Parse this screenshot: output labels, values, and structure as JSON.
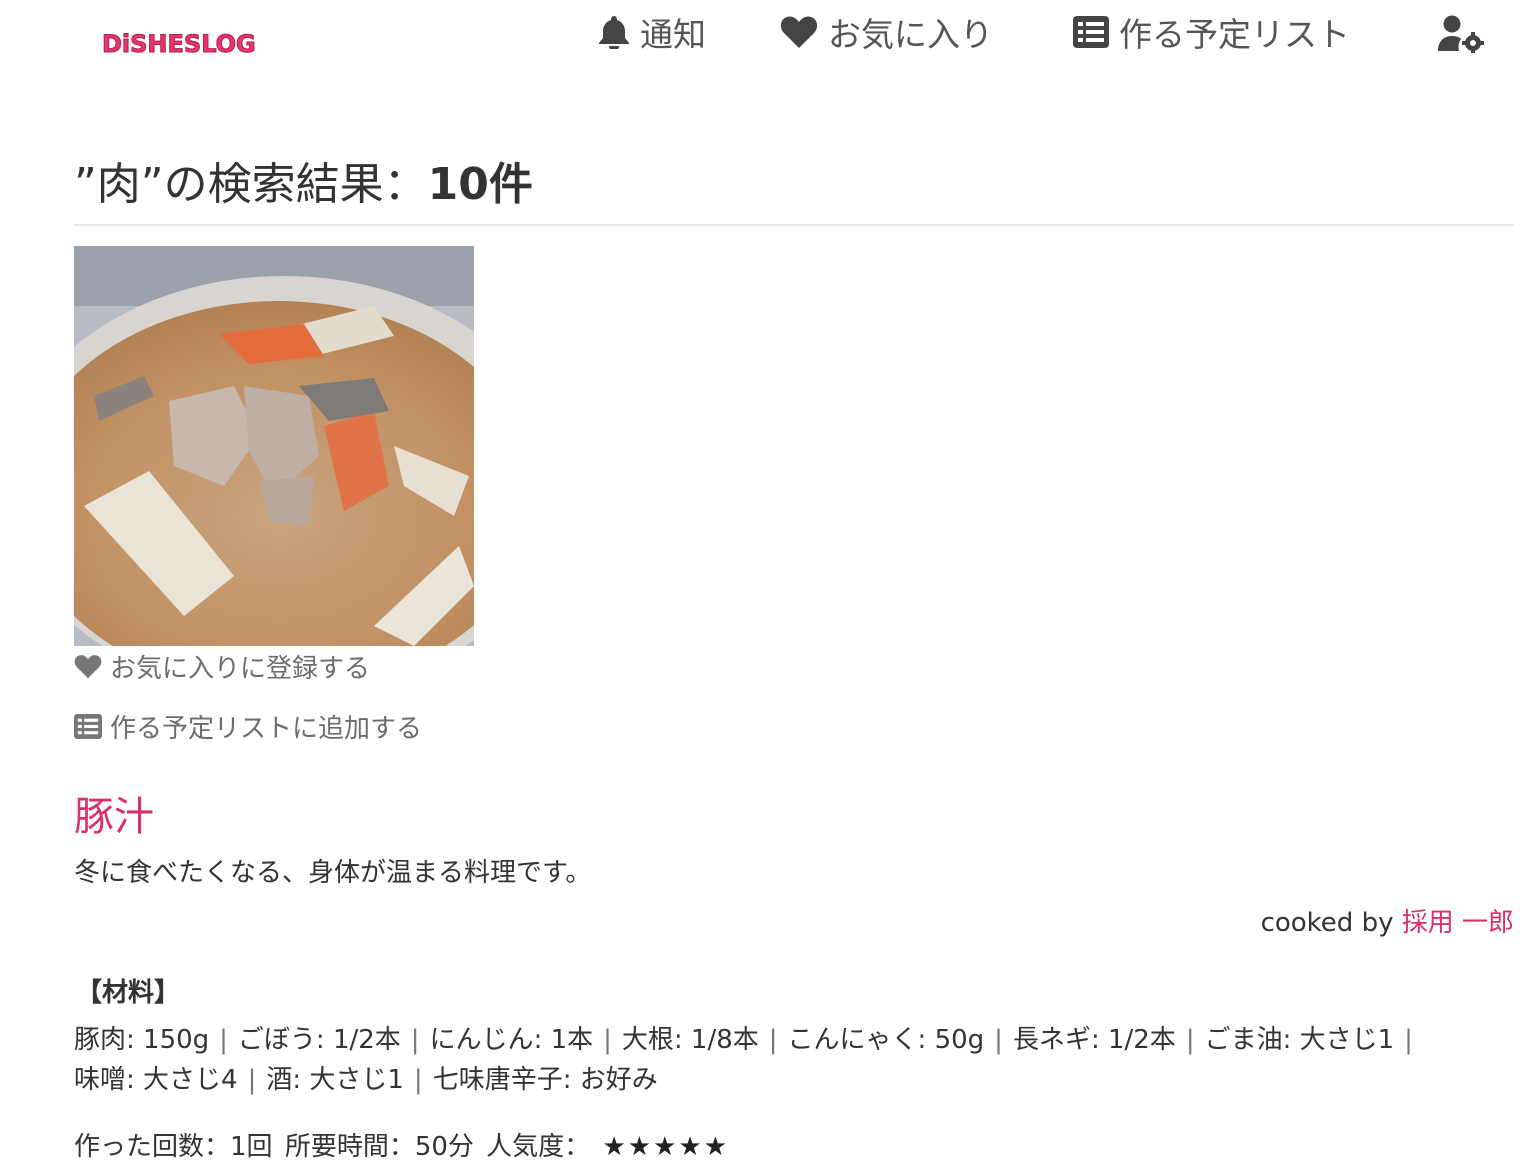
{
  "header": {
    "logo": "DiSHESLOG",
    "nav": {
      "notify": "通知",
      "favorites": "お気に入り",
      "plan_list": "作る予定リスト"
    },
    "icons": [
      "bell-icon",
      "heart-icon",
      "list-icon",
      "user-cog-icon"
    ]
  },
  "search": {
    "title_prefix": "”肉”の検索結果：",
    "count": "10件"
  },
  "recipe": {
    "actions": {
      "favorite": "お気に入りに登録する",
      "add_plan": "作る予定リストに追加する"
    },
    "title": "豚汁",
    "description": "冬に食べたくなる、身体が温まる料理です。",
    "cooked_by_label": "cooked by",
    "author": "採用 一郎",
    "ingredients_heading": "【材料】",
    "ingredients": [
      "豚肉: 150g",
      "ごぼう: 1/2本",
      "にんじん: 1本",
      "大根: 1/8本",
      "こんにゃく: 50g",
      "長ネギ: 1/2本",
      "ごま油: 大さじ1",
      "味噌: 大さじ4",
      "酒: 大さじ1",
      "七味唐辛子: お好み"
    ],
    "meta": {
      "made_count": "作った回数：1回",
      "time_required": "所要時間：50分",
      "popularity_label": "人気度：",
      "stars": "★★★★★"
    }
  },
  "colors": {
    "accent": "#d9306b",
    "text": "#333333",
    "muted": "#6c6c6c"
  }
}
